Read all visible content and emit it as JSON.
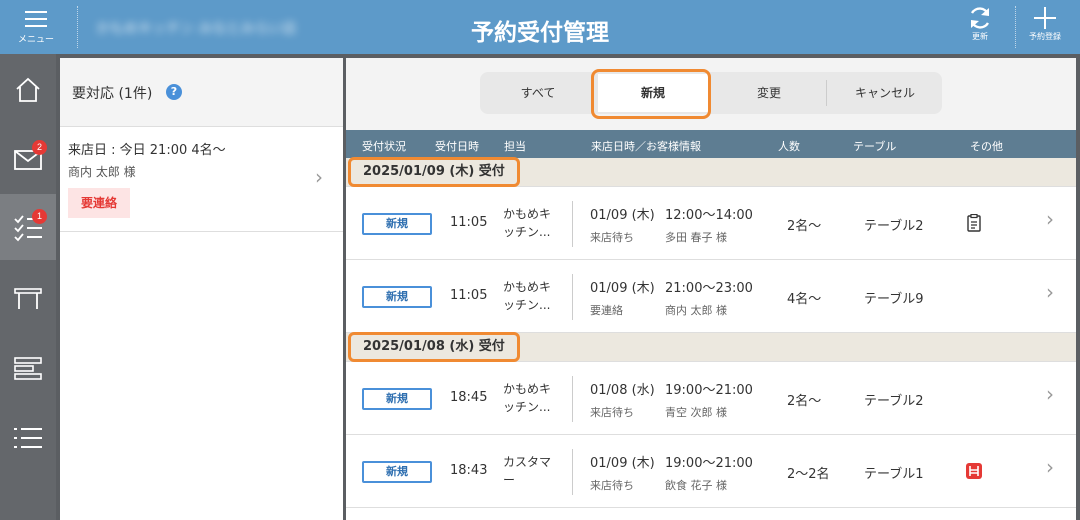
{
  "header": {
    "menu_label": "メニュー",
    "store_name": "かもめキッチン みなとみらい店",
    "title": "予約受付管理",
    "refresh_label": "更新",
    "add_label": "予約登録"
  },
  "nav": {
    "items": [
      {
        "icon": "home-icon"
      },
      {
        "icon": "mail-icon",
        "badge": "2"
      },
      {
        "icon": "checklist-icon",
        "badge": "1",
        "active": true
      },
      {
        "icon": "table-icon"
      },
      {
        "icon": "layout-icon"
      },
      {
        "icon": "list-icon"
      }
    ]
  },
  "todo": {
    "title": "要対応 (1件)",
    "help": "?",
    "item": {
      "date": "来店日 : 今日 21:00 4名〜",
      "name": "商内 太郎 様",
      "tag": "要連絡"
    }
  },
  "tabs": [
    "すべて",
    "新規",
    "変更",
    "キャンセル"
  ],
  "active_tab": "新規",
  "columns": [
    "受付状況",
    "受付日時",
    "担当",
    "来店日時／お客様情報",
    "人数",
    "テーブル",
    "その他"
  ],
  "groups": [
    {
      "label": "2025/01/09 (木) 受付",
      "rows": [
        {
          "status": "新規",
          "time": "11:05",
          "staff1": "かもめキ",
          "staff2": "ッチン...",
          "date": "01/09 (木)",
          "range": "12:00〜14:00",
          "state": "来店待ち",
          "guest": "多田 春子 様",
          "people": "2名〜",
          "table": "テーブル2",
          "other": "memo"
        },
        {
          "status": "新規",
          "time": "11:05",
          "staff1": "かもめキ",
          "staff2": "ッチン...",
          "date": "01/09 (木)",
          "range": "21:00〜23:00",
          "state": "要連絡",
          "guest": "商内 太郎 様",
          "people": "4名〜",
          "table": "テーブル9",
          "other": ""
        }
      ]
    },
    {
      "label": "2025/01/08 (水) 受付",
      "rows": [
        {
          "status": "新規",
          "time": "18:45",
          "staff1": "かもめキ",
          "staff2": "ッチン...",
          "date": "01/08 (水)",
          "range": "19:00〜21:00",
          "state": "来店待ち",
          "guest": "青空 次郎 様",
          "people": "2名〜",
          "table": "テーブル2",
          "other": ""
        },
        {
          "status": "新規",
          "time": "18:43",
          "staff1": "カスタマ",
          "staff2": "ー",
          "date": "01/09 (木)",
          "range": "19:00〜21:00",
          "state": "来店待ち",
          "guest": "飲食 花子 様",
          "people": "2〜2名",
          "table": "テーブル1",
          "other": "highchair"
        }
      ]
    }
  ],
  "colors": {
    "header": "#5d9ac9",
    "nav": "#64676b",
    "column_header": "#5e7d92",
    "highlight": "#f08a32",
    "status_badge": "#4a90d9",
    "alert": "#e53935"
  }
}
